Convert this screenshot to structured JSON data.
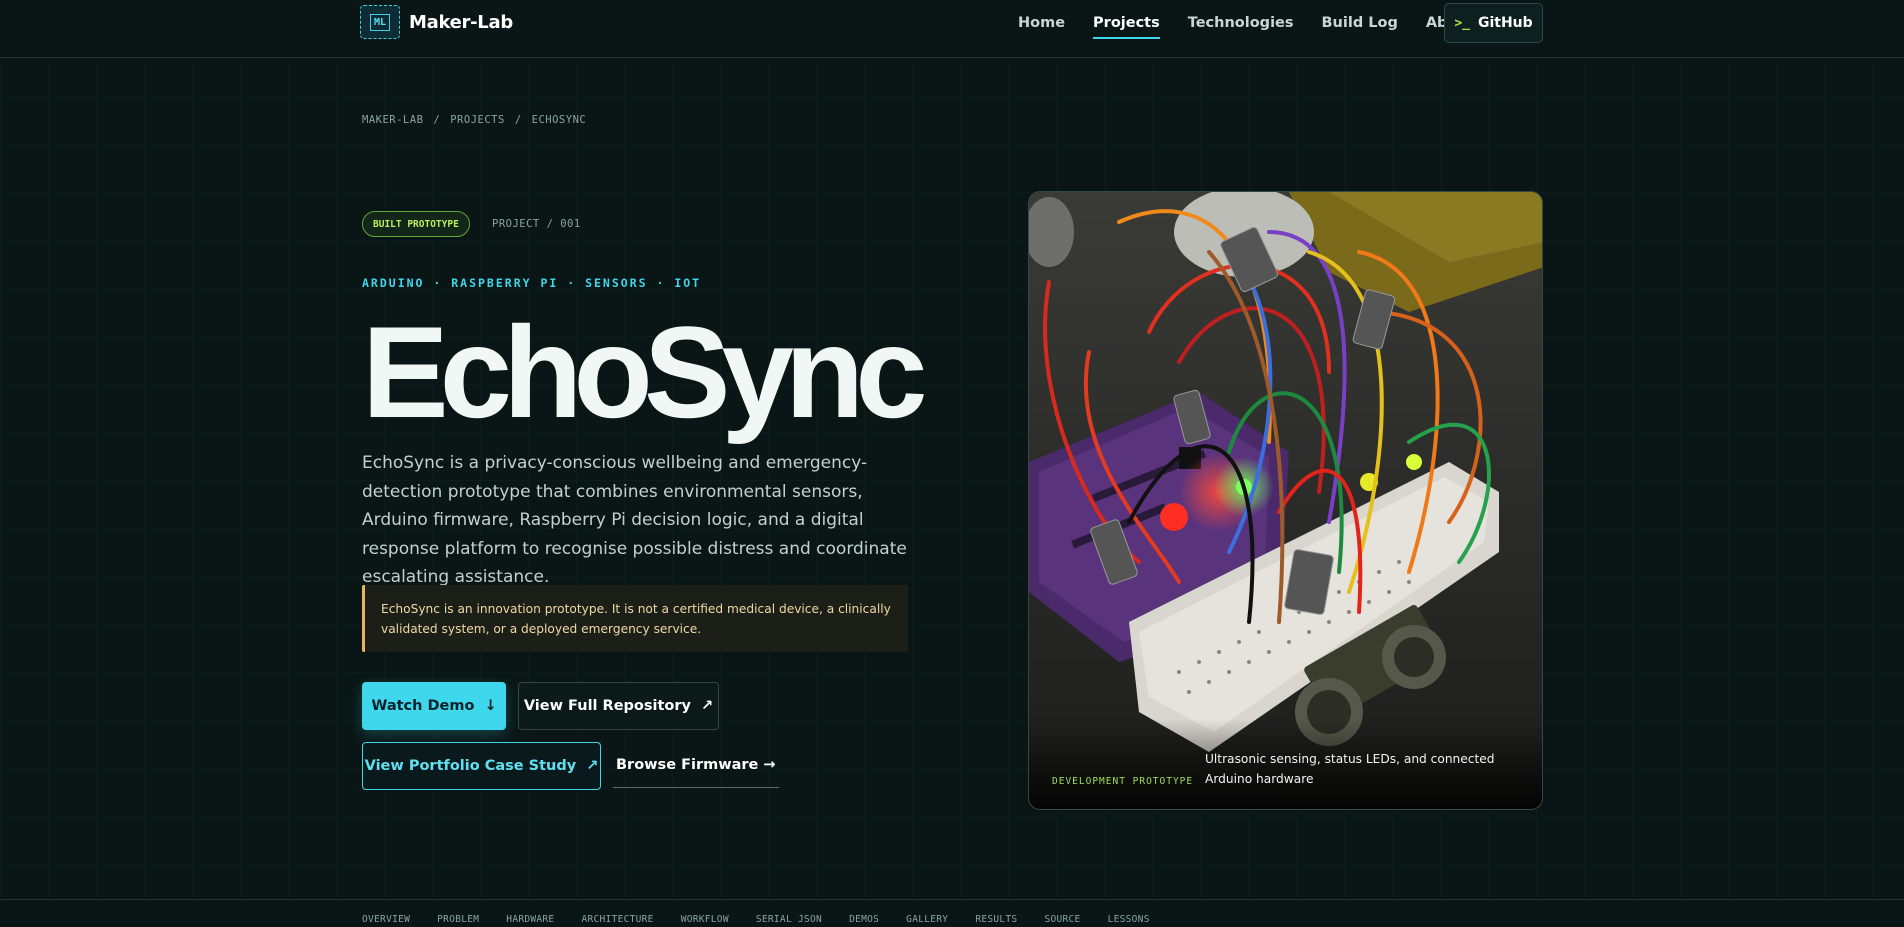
{
  "header": {
    "logo_mark": "ML",
    "logo_text": "Maker-Lab",
    "nav": [
      {
        "label": "Home",
        "active": false
      },
      {
        "label": "Projects",
        "active": true
      },
      {
        "label": "Technologies",
        "active": false
      },
      {
        "label": "Build Log",
        "active": false
      },
      {
        "label": "About",
        "active": false
      }
    ],
    "github_prompt": ">_",
    "github_label": "GitHub"
  },
  "breadcrumb": [
    "MAKER-LAB",
    "/",
    "PROJECTS",
    "/",
    "ECHOSYNC"
  ],
  "hero": {
    "status_badge": "BUILT PROTOTYPE",
    "project_number": "PROJECT / 001",
    "tags": "ARDUINO · RASPBERRY PI · SENSORS · IOT",
    "title": "EchoSync",
    "description": "EchoSync is a privacy-conscious wellbeing and emergency-detection prototype that combines environmental sensors, Arduino firmware, Raspberry Pi decision logic, and a digital response platform to recognise possible distress and coordinate escalating assistance.",
    "notice": "EchoSync is an innovation prototype. It is not a certified medical device, a clinically validated system, or a deployed emergency service.",
    "buttons": {
      "watch_demo": "Watch Demo",
      "watch_demo_icon": "↓",
      "repo": "View Full Repository",
      "repo_icon": "↗",
      "case_study": "View Portfolio Case Study",
      "case_study_icon": "↗",
      "firmware": "Browse Firmware →"
    }
  },
  "photo": {
    "tag": "DEVELOPMENT PROTOTYPE",
    "caption": "Ultrasonic sensing, status LEDs, and connected Arduino hardware"
  },
  "section_nav": [
    "OVERVIEW",
    "PROBLEM",
    "HARDWARE",
    "ARCHITECTURE",
    "WORKFLOW",
    "SERIAL JSON",
    "DEMOS",
    "GALLERY",
    "RESULTS",
    "SOURCE",
    "LESSONS"
  ],
  "colors": {
    "background": "#0a1616",
    "accent_cyan": "#3fd7ec",
    "accent_green": "#b8f060",
    "notice_amber": "#e8b55c"
  }
}
